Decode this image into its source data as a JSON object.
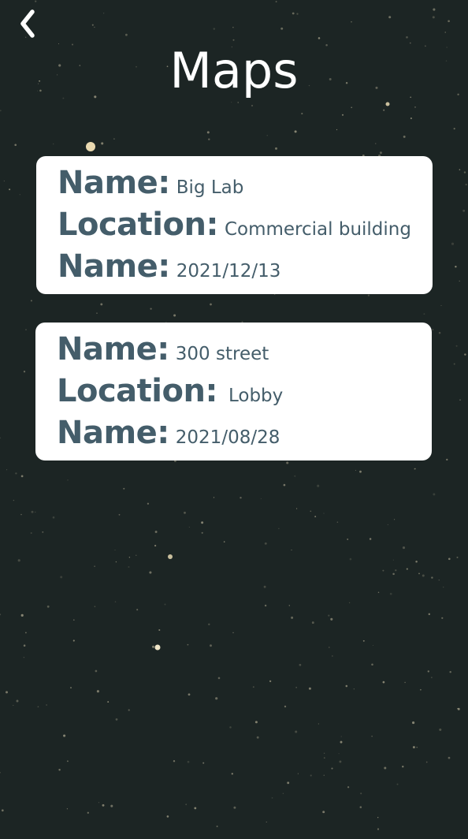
{
  "header": {
    "back_icon": "chevron-left-icon",
    "title": "Maps"
  },
  "maps": [
    {
      "name_label": "Name:",
      "name": "Big Lab",
      "location_label": "Location:",
      "location": "Commercial building",
      "date_label": "Name:",
      "date": "2021/12/13"
    },
    {
      "name_label": "Name:",
      "name": "300 street",
      "location_label": "Location:",
      "location": "Lobby",
      "date_label": "Name:",
      "date": "2021/08/28"
    }
  ],
  "colors": {
    "background": "#1c2524",
    "card": "#ffffff",
    "card_text": "#445d6a",
    "title": "#ffffff"
  }
}
